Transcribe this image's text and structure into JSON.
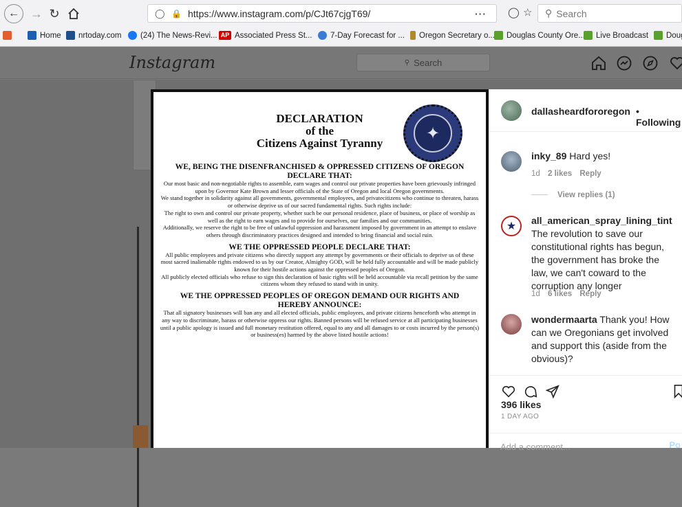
{
  "browser": {
    "url": "https://www.instagram.com/p/CJt67cjgT69/",
    "more_label": "···",
    "search_placeholder": "Search"
  },
  "bookmarks": [
    {
      "label": "Home",
      "color": "#1a5fb4"
    },
    {
      "label": "nrtoday.com",
      "color": "#1f4e8c"
    },
    {
      "label": "(24) The News-Revi...",
      "color": "#1877f2"
    },
    {
      "label": "Associated Press St...",
      "color": "#d40000"
    },
    {
      "label": "7-Day Forecast for ...",
      "color": "#3a7bd5"
    },
    {
      "label": "Oregon Secretary o...",
      "color": "#b08a2a"
    },
    {
      "label": "Douglas County Ore...",
      "color": "#5aa02c"
    },
    {
      "label": "Live Broadcast",
      "color": "#5aa02c"
    },
    {
      "label": "Doug",
      "color": "#5aa02c"
    }
  ],
  "instagram": {
    "logo": "Instagram",
    "search_placeholder": "Search"
  },
  "document": {
    "title_line1": "DECLARATION",
    "title_line2": "of the",
    "title_line3": "Citizens Against Tyranny",
    "seal_text": "CITIZENS AGAINST TYRANNY",
    "section1_heading": "WE, BEING THE DISENFRANCHISED & OPPRESSED CITIZENS OF OREGON DECLARE THAT:",
    "section1_para1": "Our most basic and non-negotiable rights to assemble, earn wages and control our private properties have been grievously infringed upon by Governor Kate Brown and lesser officials of the State of Oregon and local Oregon governments.",
    "section1_para2": "We stand together in solidarity against all governments, governmental employees, and privatecitizens who continue to threaten, harass or otherwise deprive us of our sacred fundamental rights. Such rights include:",
    "section1_para3": "The right to own and control our private property, whether such be our personal residence, place of business, or place of worship as well as the right to earn wages and to provide for ourselves, our families and our communities.",
    "section1_para4": "Additionally, we reserve the right to be free of unlawful oppression and harassment imposed by government in an attempt to enslave others through discriminatory practices designed and intended to bring financial and social ruin.",
    "section2_heading": "WE THE OPPRESSED PEOPLE DECLARE THAT:",
    "section2_para1": "All public employees and private citizens who directly support any attempt by governments or their officials to deprive us of these most sacred inalienable rights endowed to us by our Creator, Almighty GOD, will be held fully accountable and will be made publicly known for their hostile actions against the oppressed peoples of Oregon.",
    "section2_para2": "All publicly elected officials who refuse to sign this declaration of basic rights will be held accountable via recall petition by the same citizens whom they refused to stand with in unity.",
    "section3_heading": "WE THE OPPRESSED PEOPLES OF OREGON DEMAND OUR RIGHTS AND HEREBY ANNOUNCE:",
    "section3_para1": "That all signatory businesses will ban any and all elected officials, public employees, and private citizens henceforth who attempt in any way to discriminate, harass or otherwise oppress our rights. Banned persons will be refused service at all participating businesses until a public apology is issued and full monetary restitution offered, equal to any and all damages to or costs incurred by the person(s) or business(es) harmed by the above listed hostile actions!"
  },
  "post": {
    "author": "dallasheardfororegon",
    "follow_status": "• Following",
    "comments": [
      {
        "user": "inky_89",
        "text": "Hard yes!",
        "age": "1d",
        "likes": "2 likes",
        "reply": "Reply",
        "view_replies": "View replies (1)"
      },
      {
        "user": "all_american_spray_lining_tint",
        "text": "The revolution to save our constitutional rights has begun, the government has broke the law, we can't coward to the corruption any longer",
        "age": "1d",
        "likes": "6 likes",
        "reply": "Reply"
      },
      {
        "user": "wondermaarta",
        "text": "Thank you! How can we Oregonians get involved and support this (aside from the obvious)?"
      }
    ],
    "likes_count": "396 likes",
    "time_ago": "1 DAY AGO",
    "add_comment_placeholder": "Add a comment...",
    "post_label": "Po"
  }
}
